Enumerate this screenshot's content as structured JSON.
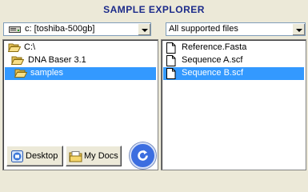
{
  "title": "SAMPLE EXPLORER",
  "drive_combo": {
    "value": "c: [toshiba-500gb]",
    "icon": "hard-drive-icon"
  },
  "filter_combo": {
    "value": "All supported files"
  },
  "folders": [
    {
      "label": "C:\\",
      "icon": "open-folder-icon",
      "selected": false
    },
    {
      "label": "DNA Baser 3.1",
      "icon": "open-folder-icon",
      "selected": false
    },
    {
      "label": "samples",
      "icon": "open-folder-icon",
      "selected": true
    }
  ],
  "files": [
    {
      "label": "Reference.Fasta",
      "icon": "document-icon",
      "selected": false
    },
    {
      "label": "Sequence A.scf",
      "icon": "document-icon",
      "selected": false
    },
    {
      "label": "Sequence B.scf",
      "icon": "document-icon",
      "selected": true
    }
  ],
  "buttons": {
    "desktop": {
      "label": "Desktop",
      "icon": "desktop-icon"
    },
    "mydocs": {
      "label": "My Docs",
      "icon": "documents-folder-icon"
    },
    "refresh": {
      "icon": "refresh-icon"
    }
  },
  "colors": {
    "title": "#1b2a8a",
    "selection": "#3399ff",
    "background": "#ece9d8"
  }
}
